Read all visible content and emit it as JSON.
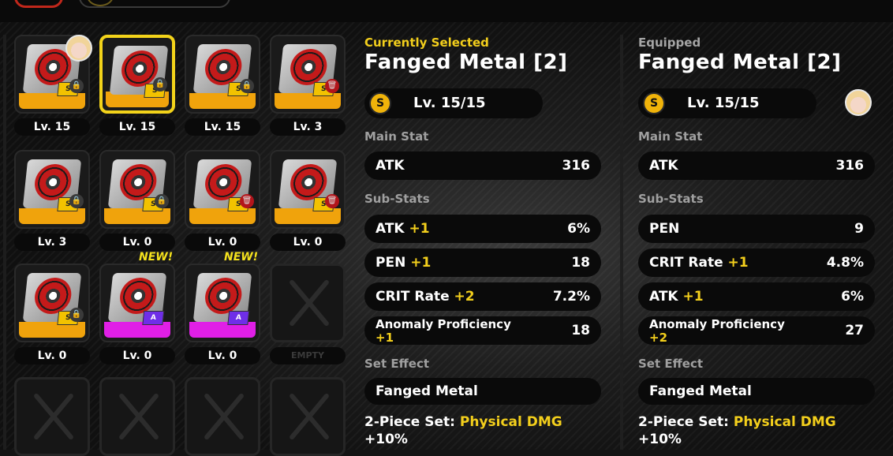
{
  "inventory": {
    "slots": [
      {
        "level": "Lv. 15",
        "locked": true,
        "lock_color": "gray",
        "tag": "S",
        "base": "orange",
        "selected": false,
        "is_new": false,
        "empty": false
      },
      {
        "level": "Lv. 15",
        "locked": true,
        "lock_color": "gray",
        "tag": "S",
        "base": "orange",
        "selected": true,
        "is_new": false,
        "empty": false
      },
      {
        "level": "Lv. 15",
        "locked": true,
        "lock_color": "gray",
        "tag": "S",
        "base": "orange",
        "selected": false,
        "is_new": false,
        "empty": false
      },
      {
        "level": "Lv. 3",
        "locked": true,
        "lock_color": "red",
        "tag": "S",
        "base": "orange",
        "selected": false,
        "is_new": false,
        "empty": false
      },
      {
        "level": "Lv. 3",
        "locked": true,
        "lock_color": "gray",
        "tag": "S",
        "base": "orange",
        "selected": false,
        "is_new": false,
        "empty": false
      },
      {
        "level": "Lv. 0",
        "locked": true,
        "lock_color": "gray",
        "tag": "S",
        "base": "orange",
        "selected": false,
        "is_new": false,
        "empty": false
      },
      {
        "level": "Lv. 0",
        "locked": true,
        "lock_color": "red",
        "tag": "S",
        "base": "orange",
        "selected": false,
        "is_new": false,
        "empty": false
      },
      {
        "level": "Lv. 0",
        "locked": true,
        "lock_color": "red",
        "tag": "S",
        "base": "orange",
        "selected": false,
        "is_new": false,
        "empty": false
      },
      {
        "level": "Lv. 0",
        "locked": true,
        "lock_color": "gray",
        "tag": "S",
        "base": "orange",
        "selected": false,
        "is_new": false,
        "empty": false
      },
      {
        "level": "Lv. 0",
        "locked": false,
        "lock_color": "",
        "tag": "A",
        "base": "purple",
        "selected": false,
        "is_new": true,
        "empty": false
      },
      {
        "level": "Lv. 0",
        "locked": false,
        "lock_color": "",
        "tag": "A",
        "base": "purple",
        "selected": false,
        "is_new": true,
        "empty": false
      },
      {
        "level": "EMPTY",
        "empty": true
      },
      {
        "level": "",
        "empty": true
      },
      {
        "level": "",
        "empty": true
      },
      {
        "level": "",
        "empty": true
      },
      {
        "level": "",
        "empty": true
      }
    ],
    "new_label": "NEW!",
    "lock_glyph": "🔒",
    "trash_glyph": "🗑"
  },
  "selected_panel": {
    "header": "Currently Selected",
    "name": "Fanged Metal [2]",
    "rank_icon": "S",
    "level": "Lv. 15/15",
    "main_stat_title": "Main Stat",
    "main_stat": {
      "label": "ATK",
      "value": "316"
    },
    "sub_stats_title": "Sub-Stats",
    "sub_stats": [
      {
        "label": "ATK",
        "plus": "+1",
        "value": "6%"
      },
      {
        "label": "PEN",
        "plus": "+1",
        "value": "18"
      },
      {
        "label": "CRIT Rate",
        "plus": "+2",
        "value": "7.2%"
      },
      {
        "label": "Anomaly Proficiency",
        "plus": "+1",
        "value": "18"
      }
    ],
    "set_effect_title": "Set Effect",
    "set_name": "Fanged Metal",
    "piece_label": "2-Piece Set:",
    "piece_effect": "Physical DMG",
    "piece_value": "+10%"
  },
  "equipped_panel": {
    "header": "Equipped",
    "name": "Fanged Metal [2]",
    "rank_icon": "S",
    "level": "Lv. 15/15",
    "main_stat_title": "Main Stat",
    "main_stat": {
      "label": "ATK",
      "value": "316"
    },
    "sub_stats_title": "Sub-Stats",
    "sub_stats": [
      {
        "label": "PEN",
        "plus": "",
        "value": "9"
      },
      {
        "label": "CRIT Rate",
        "plus": "+1",
        "value": "4.8%"
      },
      {
        "label": "ATK",
        "plus": "+1",
        "value": "6%"
      },
      {
        "label": "Anomaly Proficiency",
        "plus": "+2",
        "value": "27"
      }
    ],
    "set_effect_title": "Set Effect",
    "set_name": "Fanged Metal",
    "piece_label": "2-Piece Set:",
    "piece_effect": "Physical DMG",
    "piece_value": "+10%"
  },
  "colors": {
    "accent_yellow": "#f3cf1c",
    "rarity_s_orange": "#f0a30c",
    "rarity_a_purple": "#e01fe6",
    "lock_red": "#b3151b"
  }
}
